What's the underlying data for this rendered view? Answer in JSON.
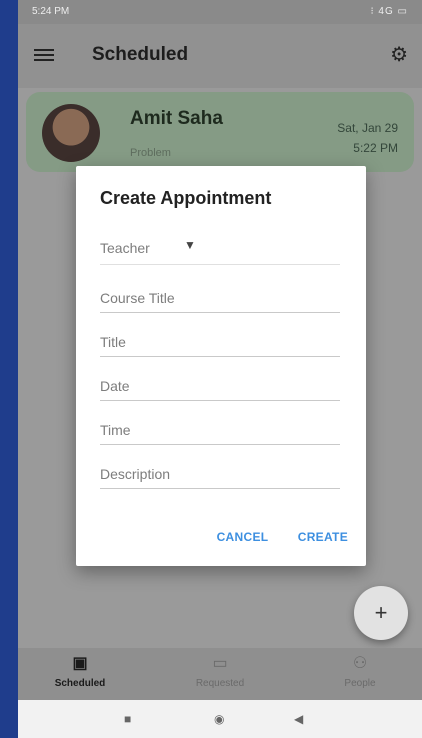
{
  "status_bar": {
    "time": "5:24 PM",
    "indicators": "⁝ 4G ▭"
  },
  "app_bar": {
    "title": "Scheduled",
    "menu_icon": "hamburger-icon",
    "settings_icon": "gear-icon"
  },
  "appointment_card": {
    "name": "Amit Saha",
    "subtitle": "Problem",
    "date": "Sat, Jan 29",
    "time": "5:22 PM"
  },
  "dialog": {
    "title": "Create Appointment",
    "teacher_select": {
      "value": "Teacher"
    },
    "fields": {
      "course_title": "Course Title",
      "title": "Title",
      "date": "Date",
      "time": "Time",
      "description": "Description"
    },
    "actions": {
      "cancel": "CANCEL",
      "create": "CREATE"
    }
  },
  "fab": {
    "label": "+"
  },
  "bottom_nav": [
    {
      "label": "Scheduled",
      "icon": "calendar-icon",
      "active": true
    },
    {
      "label": "Requested",
      "icon": "inbox-icon",
      "active": false
    },
    {
      "label": "People",
      "icon": "people-icon",
      "active": false
    }
  ],
  "system_nav": {
    "recents_glyph": "■",
    "home_glyph": "◉",
    "back_glyph": "◀"
  },
  "colors": {
    "accent": "#3d8fe0",
    "card_bg": "#859b85",
    "outer_bg": "#1f3d8c"
  }
}
